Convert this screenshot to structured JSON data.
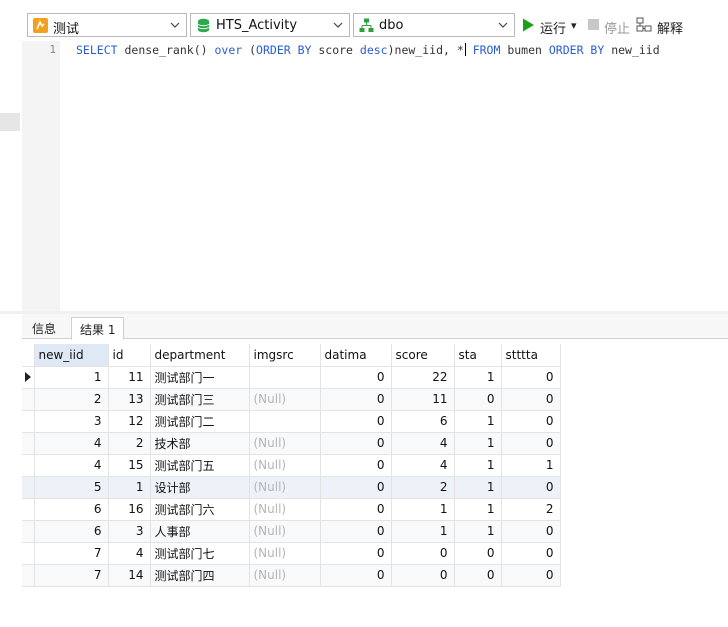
{
  "toolbar": {
    "connection": "测试",
    "database": "HTS_Activity",
    "schema": "dbo",
    "run_label": "运行",
    "run_dropdown": "▾",
    "stop_label": "停止",
    "explain_label": "解释"
  },
  "editor": {
    "line_number": "1",
    "code_tokens": [
      {
        "t": "SELECT",
        "kw": true
      },
      {
        "t": " dense_rank() ",
        "kw": false
      },
      {
        "t": "over",
        "kw": true
      },
      {
        "t": " (",
        "kw": false
      },
      {
        "t": "ORDER BY",
        "kw": true
      },
      {
        "t": " score ",
        "kw": false
      },
      {
        "t": "desc",
        "kw": true
      },
      {
        "t": ")new_iid, *",
        "kw": false
      },
      {
        "t": " FROM",
        "kw": true
      },
      {
        "t": " bumen ",
        "kw": false
      },
      {
        "t": "ORDER BY",
        "kw": true
      },
      {
        "t": " new_iid",
        "kw": false
      }
    ]
  },
  "tabs": [
    {
      "label": "信息",
      "active": false
    },
    {
      "label": "结果 1",
      "active": true
    }
  ],
  "grid": {
    "columns": [
      "new_iid",
      "id",
      "department",
      "imgsrc",
      "datima",
      "score",
      "sta",
      "stttta"
    ],
    "rows": [
      [
        "1",
        "11",
        "测试部门一",
        "",
        "0",
        "22",
        "1",
        "0"
      ],
      [
        "2",
        "13",
        "测试部门三",
        "(Null)",
        "0",
        "11",
        "0",
        "0"
      ],
      [
        "3",
        "12",
        "测试部门二",
        "",
        "0",
        "6",
        "1",
        "0"
      ],
      [
        "4",
        "2",
        "技术部",
        "(Null)",
        "0",
        "4",
        "1",
        "0"
      ],
      [
        "4",
        "15",
        "测试部门五",
        "(Null)",
        "0",
        "4",
        "1",
        "1"
      ],
      [
        "5",
        "1",
        "设计部",
        "(Null)",
        "0",
        "2",
        "1",
        "0"
      ],
      [
        "6",
        "16",
        "测试部门六",
        "(Null)",
        "0",
        "1",
        "1",
        "2"
      ],
      [
        "6",
        "3",
        "人事部",
        "(Null)",
        "0",
        "1",
        "1",
        "0"
      ],
      [
        "7",
        "4",
        "测试部门七",
        "(Null)",
        "0",
        "0",
        "0",
        "0"
      ],
      [
        "7",
        "14",
        "测试部门四",
        "(Null)",
        "0",
        "0",
        "0",
        "0"
      ]
    ]
  },
  "colors": {
    "keyword": "#2a5dcc",
    "run_green": "#1aa01a",
    "null_text": "#b5b5b5",
    "selected_header": "#dfe8f5"
  }
}
